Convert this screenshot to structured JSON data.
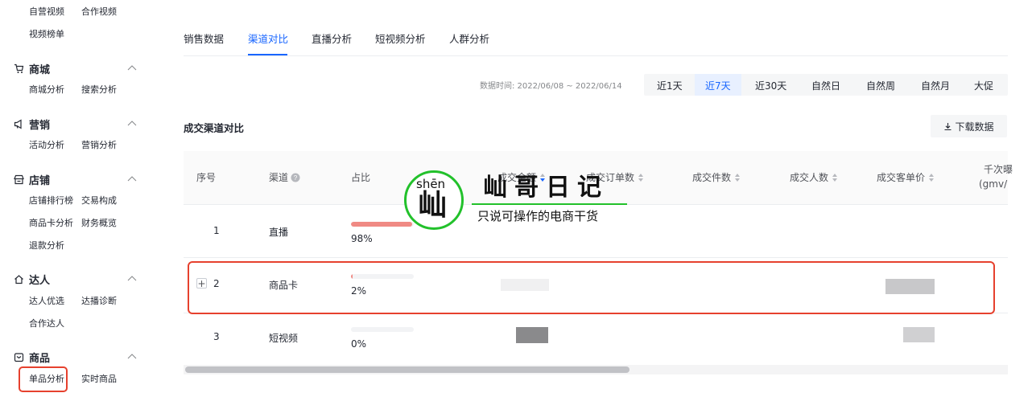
{
  "sidebar": {
    "top_items": [
      "自营视频",
      "合作视频",
      "视频榜单"
    ],
    "sections": [
      {
        "title": "商城",
        "icon": "cart-icon",
        "items": [
          "商城分析",
          "搜索分析"
        ]
      },
      {
        "title": "营销",
        "icon": "megaphone-icon",
        "items": [
          "活动分析",
          "营销分析"
        ]
      },
      {
        "title": "店铺",
        "icon": "store-icon",
        "items": [
          "店铺排行榜",
          "交易构成",
          "商品卡分析",
          "财务概览",
          "退款分析"
        ]
      },
      {
        "title": "达人",
        "icon": "home-icon",
        "items": [
          "达人优选",
          "达播诊断",
          "合作达人"
        ]
      },
      {
        "title": "商品",
        "icon": "product-icon",
        "items": [
          "单品分析",
          "实时商品"
        ]
      }
    ]
  },
  "tabs": [
    "销售数据",
    "渠道对比",
    "直播分析",
    "短视频分析",
    "人群分析"
  ],
  "active_tab": "渠道对比",
  "date": {
    "label": "数据时间: 2022/06/08 ~ 2022/06/14",
    "ranges": [
      "近1天",
      "近7天",
      "近30天",
      "自然日",
      "自然周",
      "自然月",
      "大促"
    ],
    "active": "近7天"
  },
  "section_title": "成交渠道对比",
  "download_label": "下载数据",
  "table": {
    "headers": [
      "序号",
      "渠道",
      "占比",
      "成交金额",
      "成交订单数",
      "成交件数",
      "成交人数",
      "成交客单价",
      "千次曝",
      "(gmv/"
    ],
    "rows": [
      {
        "index": "1",
        "channel": "直播",
        "share": "98%",
        "share_value": 0.98
      },
      {
        "index": "2",
        "channel": "商品卡",
        "share": "2%",
        "share_value": 0.02,
        "expand": "+"
      },
      {
        "index": "3",
        "channel": "短视频",
        "share": "0%",
        "share_value": 0.0
      }
    ]
  },
  "watermark": {
    "pinyin": "shēn",
    "char": "屾",
    "title": "屾哥日记",
    "subtitle": "只说可操作的电商干货"
  },
  "colors": {
    "accent": "#1966ff",
    "highlight": "#e6412e",
    "bar": "#f08a84",
    "watermark_green": "#22c12b"
  }
}
